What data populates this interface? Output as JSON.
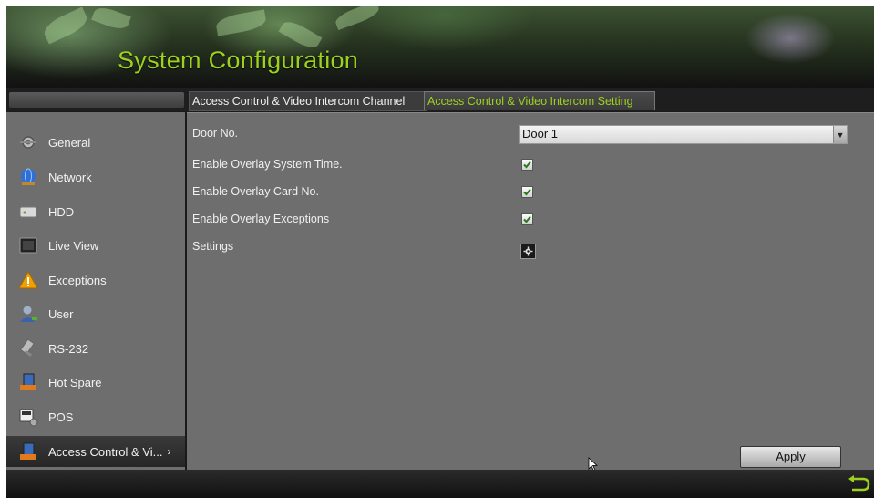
{
  "header": {
    "title": "System Configuration"
  },
  "tabs": [
    {
      "label": "Access Control & Video Intercom Channel",
      "active": false
    },
    {
      "label": "Access Control & Video Intercom Setting",
      "active": true
    }
  ],
  "sidebar": {
    "items": [
      {
        "label": "General",
        "icon": "general-icon"
      },
      {
        "label": "Network",
        "icon": "network-icon"
      },
      {
        "label": "HDD",
        "icon": "hdd-icon"
      },
      {
        "label": "Live View",
        "icon": "live-view-icon"
      },
      {
        "label": "Exceptions",
        "icon": "warning-icon"
      },
      {
        "label": "User",
        "icon": "user-icon"
      },
      {
        "label": "RS-232",
        "icon": "rs232-icon"
      },
      {
        "label": "Hot Spare",
        "icon": "hot-spare-icon"
      },
      {
        "label": "POS",
        "icon": "pos-icon"
      },
      {
        "label": "Access Control & Vi...",
        "icon": "access-control-icon",
        "active": true
      }
    ]
  },
  "form": {
    "door_no_label": "Door No.",
    "door_no_value": "Door 1",
    "overlay_time_label": "Enable Overlay System Time.",
    "overlay_time_checked": true,
    "overlay_card_label": "Enable Overlay Card No.",
    "overlay_card_checked": true,
    "overlay_exceptions_label": "Enable Overlay Exceptions",
    "overlay_exceptions_checked": true,
    "settings_label": "Settings"
  },
  "actions": {
    "apply_label": "Apply"
  },
  "colors": {
    "accent": "#9cd21e",
    "panel": "#6e6e6e",
    "dark": "#1a1a1a"
  }
}
